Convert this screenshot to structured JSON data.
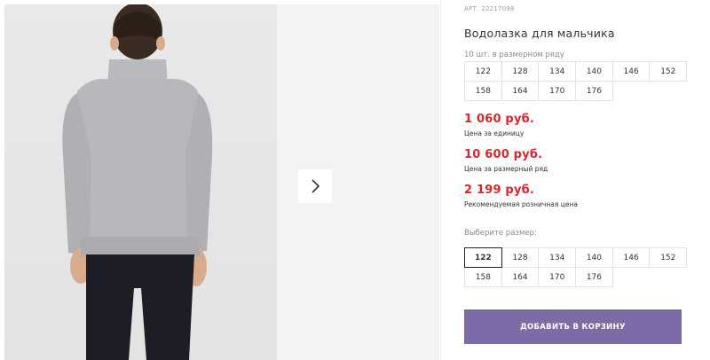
{
  "product": {
    "sku_label": "АРТ.",
    "sku_value": "22217098",
    "title": "Водолазка для мальчика"
  },
  "size_row": {
    "label": "10 шт. в размерном ряду",
    "sizes": [
      "122",
      "128",
      "134",
      "140",
      "146",
      "152",
      "158",
      "164",
      "170",
      "176"
    ]
  },
  "prices": {
    "unit_price": "1 060 руб.",
    "unit_note": "Цена за единицу",
    "row_price": "10 600 руб.",
    "row_note": "Цена за размерный ряд",
    "retail_price": "2 199 руб.",
    "retail_note": "Рекомендуемая розничная цена"
  },
  "size_select": {
    "label": "Выберите размер:",
    "selected": "122",
    "sizes": [
      "122",
      "128",
      "134",
      "140",
      "146",
      "152",
      "158",
      "164",
      "170",
      "176"
    ]
  },
  "cart": {
    "button_label": "ДОБАВИТЬ В КОРЗИНУ"
  },
  "gallery": {
    "next_icon": "chevron-right-icon"
  },
  "colors": {
    "accent": "#7d6aa6",
    "price": "#d7262f"
  }
}
